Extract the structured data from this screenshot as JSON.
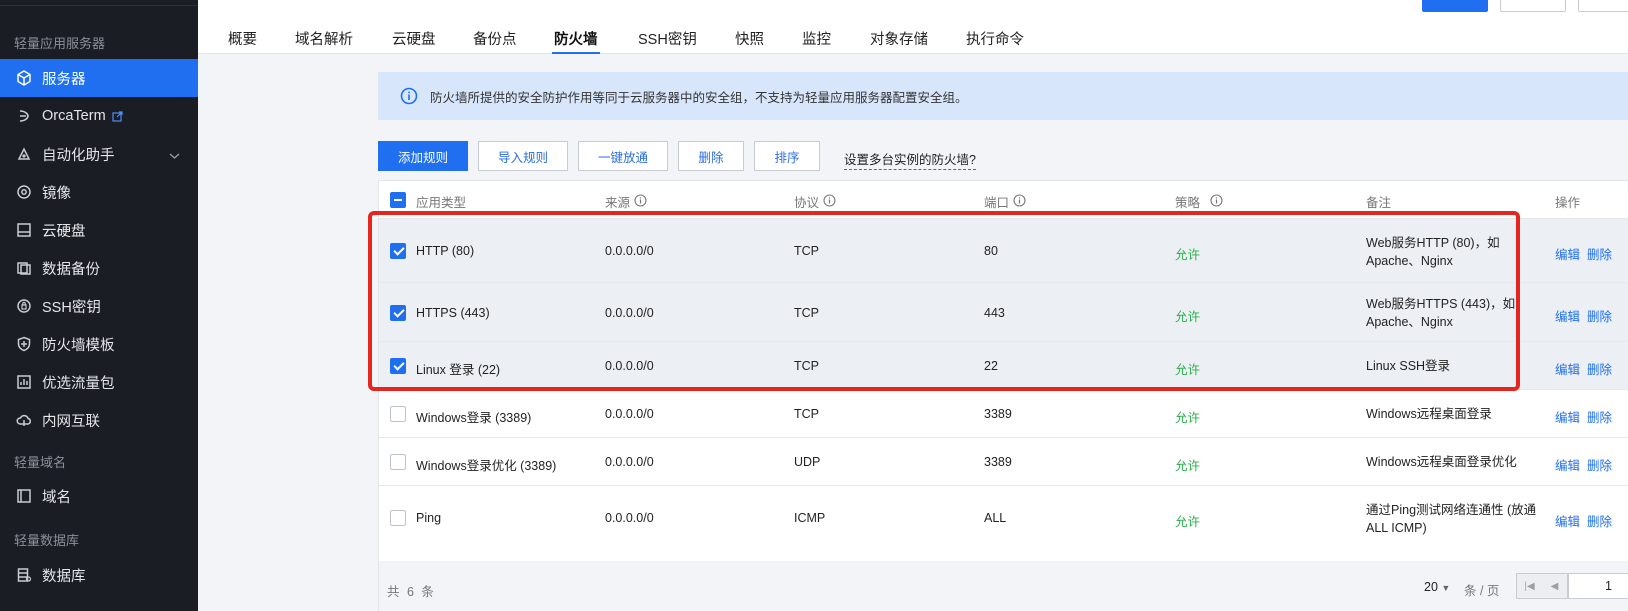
{
  "sidebar": {
    "section_server": "轻量应用服务器",
    "items": [
      {
        "label": "服务器",
        "icon": "cube-icon"
      },
      {
        "label": "OrcaTerm",
        "icon": "terminal-icon"
      },
      {
        "label": "自动化助手",
        "icon": "automation-icon"
      },
      {
        "label": "镜像",
        "icon": "image-disc-icon"
      },
      {
        "label": "云硬盘",
        "icon": "disk-icon"
      },
      {
        "label": "数据备份",
        "icon": "backup-icon"
      },
      {
        "label": "SSH密钥",
        "icon": "key-icon"
      },
      {
        "label": "防火墙模板",
        "icon": "shield-icon"
      },
      {
        "label": "优选流量包",
        "icon": "traffic-icon"
      },
      {
        "label": "内网互联",
        "icon": "cloud-link-icon"
      }
    ],
    "section_domain": "轻量域名",
    "domain_item": {
      "label": "域名",
      "icon": "domain-icon"
    },
    "section_db": "轻量数据库",
    "db_item": {
      "label": "数据库",
      "icon": "database-icon"
    }
  },
  "tabs": [
    "概要",
    "域名解析",
    "云硬盘",
    "备份点",
    "防火墙",
    "SSH密钥",
    "快照",
    "监控",
    "对象存储",
    "执行命令"
  ],
  "active_tab": "防火墙",
  "notice": "防火墙所提供的安全防护作用等同于云服务器中的安全组，不支持为轻量应用服务器配置安全组。",
  "toolbar": {
    "add": "添加规则",
    "import": "导入规则",
    "allow_all": "一键放通",
    "delete": "删除",
    "sort": "排序",
    "help_link": "设置多台实例的防火墙?"
  },
  "columns": {
    "app_type": "应用类型",
    "source": "来源",
    "protocol": "协议",
    "port": "端口",
    "policy": "策略",
    "note": "备注",
    "actions": "操作"
  },
  "rows": [
    {
      "app": "HTTP (80)",
      "source": "0.0.0.0/0",
      "protocol": "TCP",
      "port": "80",
      "policy": "允许",
      "note": "Web服务HTTP (80)，如Apache、Nginx",
      "checked": true
    },
    {
      "app": "HTTPS (443)",
      "source": "0.0.0.0/0",
      "protocol": "TCP",
      "port": "443",
      "policy": "允许",
      "note": "Web服务HTTPS (443)，如Apache、Nginx",
      "checked": true
    },
    {
      "app": "Linux 登录 (22)",
      "source": "0.0.0.0/0",
      "protocol": "TCP",
      "port": "22",
      "policy": "允许",
      "note": "Linux SSH登录",
      "checked": true
    },
    {
      "app": "Windows登录 (3389)",
      "source": "0.0.0.0/0",
      "protocol": "TCP",
      "port": "3389",
      "policy": "允许",
      "note": "Windows远程桌面登录",
      "checked": false
    },
    {
      "app": "Windows登录优化 (3389)",
      "source": "0.0.0.0/0",
      "protocol": "UDP",
      "port": "3389",
      "policy": "允许",
      "note": "Windows远程桌面登录优化",
      "checked": false
    },
    {
      "app": "Ping",
      "source": "0.0.0.0/0",
      "protocol": "ICMP",
      "port": "ALL",
      "policy": "允许",
      "note": "通过Ping测试网络连通性 (放通ALL ICMP)",
      "checked": false
    }
  ],
  "row_actions": {
    "edit": "编辑",
    "delete": "删除"
  },
  "footer": {
    "total": "共 6 条",
    "page_size": "20",
    "page_unit": "条 / 页",
    "page": "1"
  },
  "colors": {
    "accent": "#1f6ff0",
    "allow": "#2ab04a",
    "highlight": "#e5261f"
  }
}
